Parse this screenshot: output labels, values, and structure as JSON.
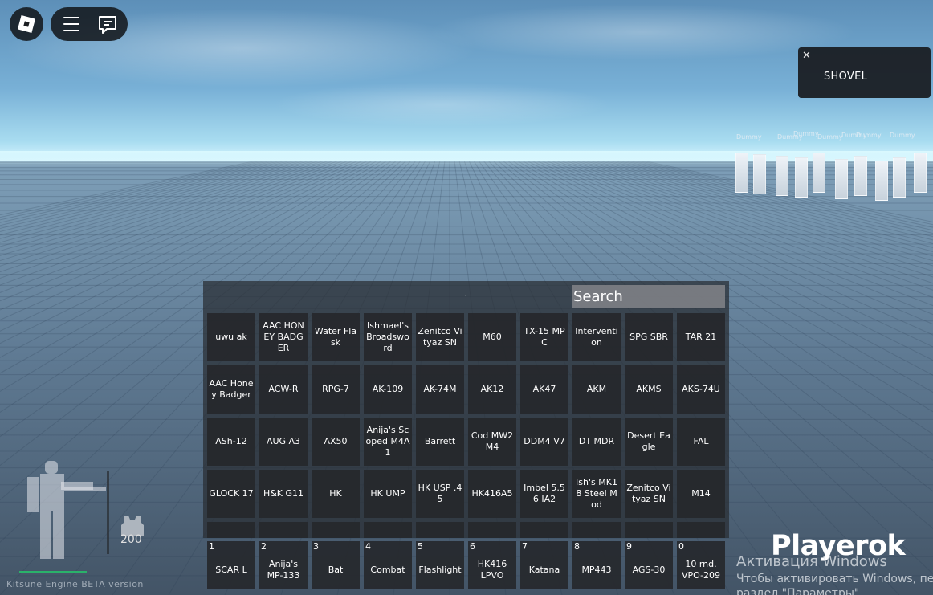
{
  "topbar": {
    "roblox_icon": "roblox-logo-icon",
    "menu_icon": "hamburger-menu-icon",
    "chat_icon": "chat-bubble-icon"
  },
  "notification": {
    "close_glyph": "✕",
    "text": "SHOVEL"
  },
  "dummies": {
    "label": "Dummy"
  },
  "inventory": {
    "dot": ".",
    "search_placeholder": "Search",
    "items": [
      [
        "uwu ak",
        "AAC HONEY BADGER",
        "Water Flask",
        "Ishmael's Broadsword",
        "Zenitco Vityaz SN",
        "M60",
        "TX-15 MPC",
        "Intervention",
        "SPG SBR",
        "TAR 21"
      ],
      [
        "AAC Honey Badger",
        "ACW-R",
        "RPG-7",
        "AK-109",
        "AK-74M",
        "AK12",
        "AK47",
        "AKM",
        "AKMS",
        "AKS-74U"
      ],
      [
        "ASh-12",
        "AUG A3",
        "AX50",
        "Anija's Scoped M4A1",
        "Barrett",
        "Cod MW2 M4",
        "DDM4 V7",
        "DT MDR",
        "Desert Eagle",
        "FAL"
      ],
      [
        "GLOCK 17",
        "H&K G11",
        "HK",
        "HK UMP",
        "HK USP .45",
        "HK416A5",
        "Imbel 5.56 IA2",
        "Ish's MK18 Steel Mod",
        "Zenitco Vityaz SN",
        "M14"
      ],
      [
        "",
        "",
        "",
        "",
        "",
        "",
        "",
        "",
        "",
        ""
      ]
    ]
  },
  "hotbar": [
    {
      "key": "1",
      "label": "SCAR L"
    },
    {
      "key": "2",
      "label": "Anija's MP-133"
    },
    {
      "key": "3",
      "label": "Bat"
    },
    {
      "key": "4",
      "label": "Combat"
    },
    {
      "key": "5",
      "label": "Flashlight"
    },
    {
      "key": "6",
      "label": "HK416 LPVO"
    },
    {
      "key": "7",
      "label": "Katana"
    },
    {
      "key": "8",
      "label": "MP443"
    },
    {
      "key": "9",
      "label": "AGS-30"
    },
    {
      "key": "0",
      "label": "10 rnd. VPO-209"
    }
  ],
  "status": {
    "armor_value": "200",
    "engine_label": "Kitsune Engine BETA version"
  },
  "watermark": {
    "brand": "Playerok",
    "activation_title": "Активация Windows",
    "activation_line1": "Чтобы активировать Windows, пере",
    "activation_line2": "раздел \"Параметры\"."
  },
  "colors": {
    "health_green": "#2ab26a",
    "panel_bg": "#2c3036",
    "tile_bg": "#26282c"
  }
}
